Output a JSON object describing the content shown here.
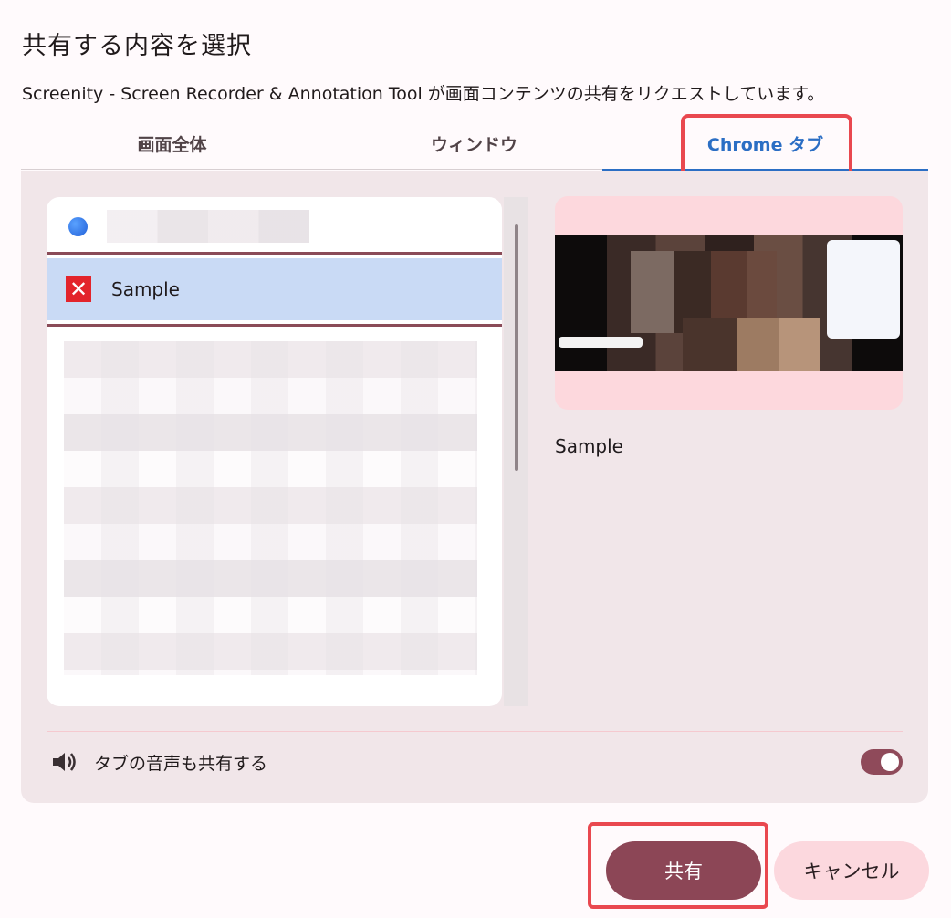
{
  "dialog": {
    "title": "共有する内容を選択",
    "subtitle": "Screenity - Screen Recorder & Annotation Tool が画面コンテンツの共有をリクエストしています。"
  },
  "tabs": [
    {
      "label": "画面全体",
      "selected": false
    },
    {
      "label": "ウィンドウ",
      "selected": false
    },
    {
      "label": "Chrome タブ",
      "selected": true
    }
  ],
  "tab_list": {
    "selected_item": {
      "label": "Sample",
      "icon": "red-x-favicon"
    }
  },
  "preview": {
    "label": "Sample"
  },
  "audio": {
    "label": "タブの音声も共有する",
    "icon": "speaker-icon",
    "enabled": true
  },
  "buttons": {
    "share": "共有",
    "cancel": "キャンセル"
  },
  "colors": {
    "accent_tab": "#2b6ec4",
    "primary_button": "#8c4656",
    "highlight": "#e9484f",
    "selected_row": "#c9daf5"
  }
}
